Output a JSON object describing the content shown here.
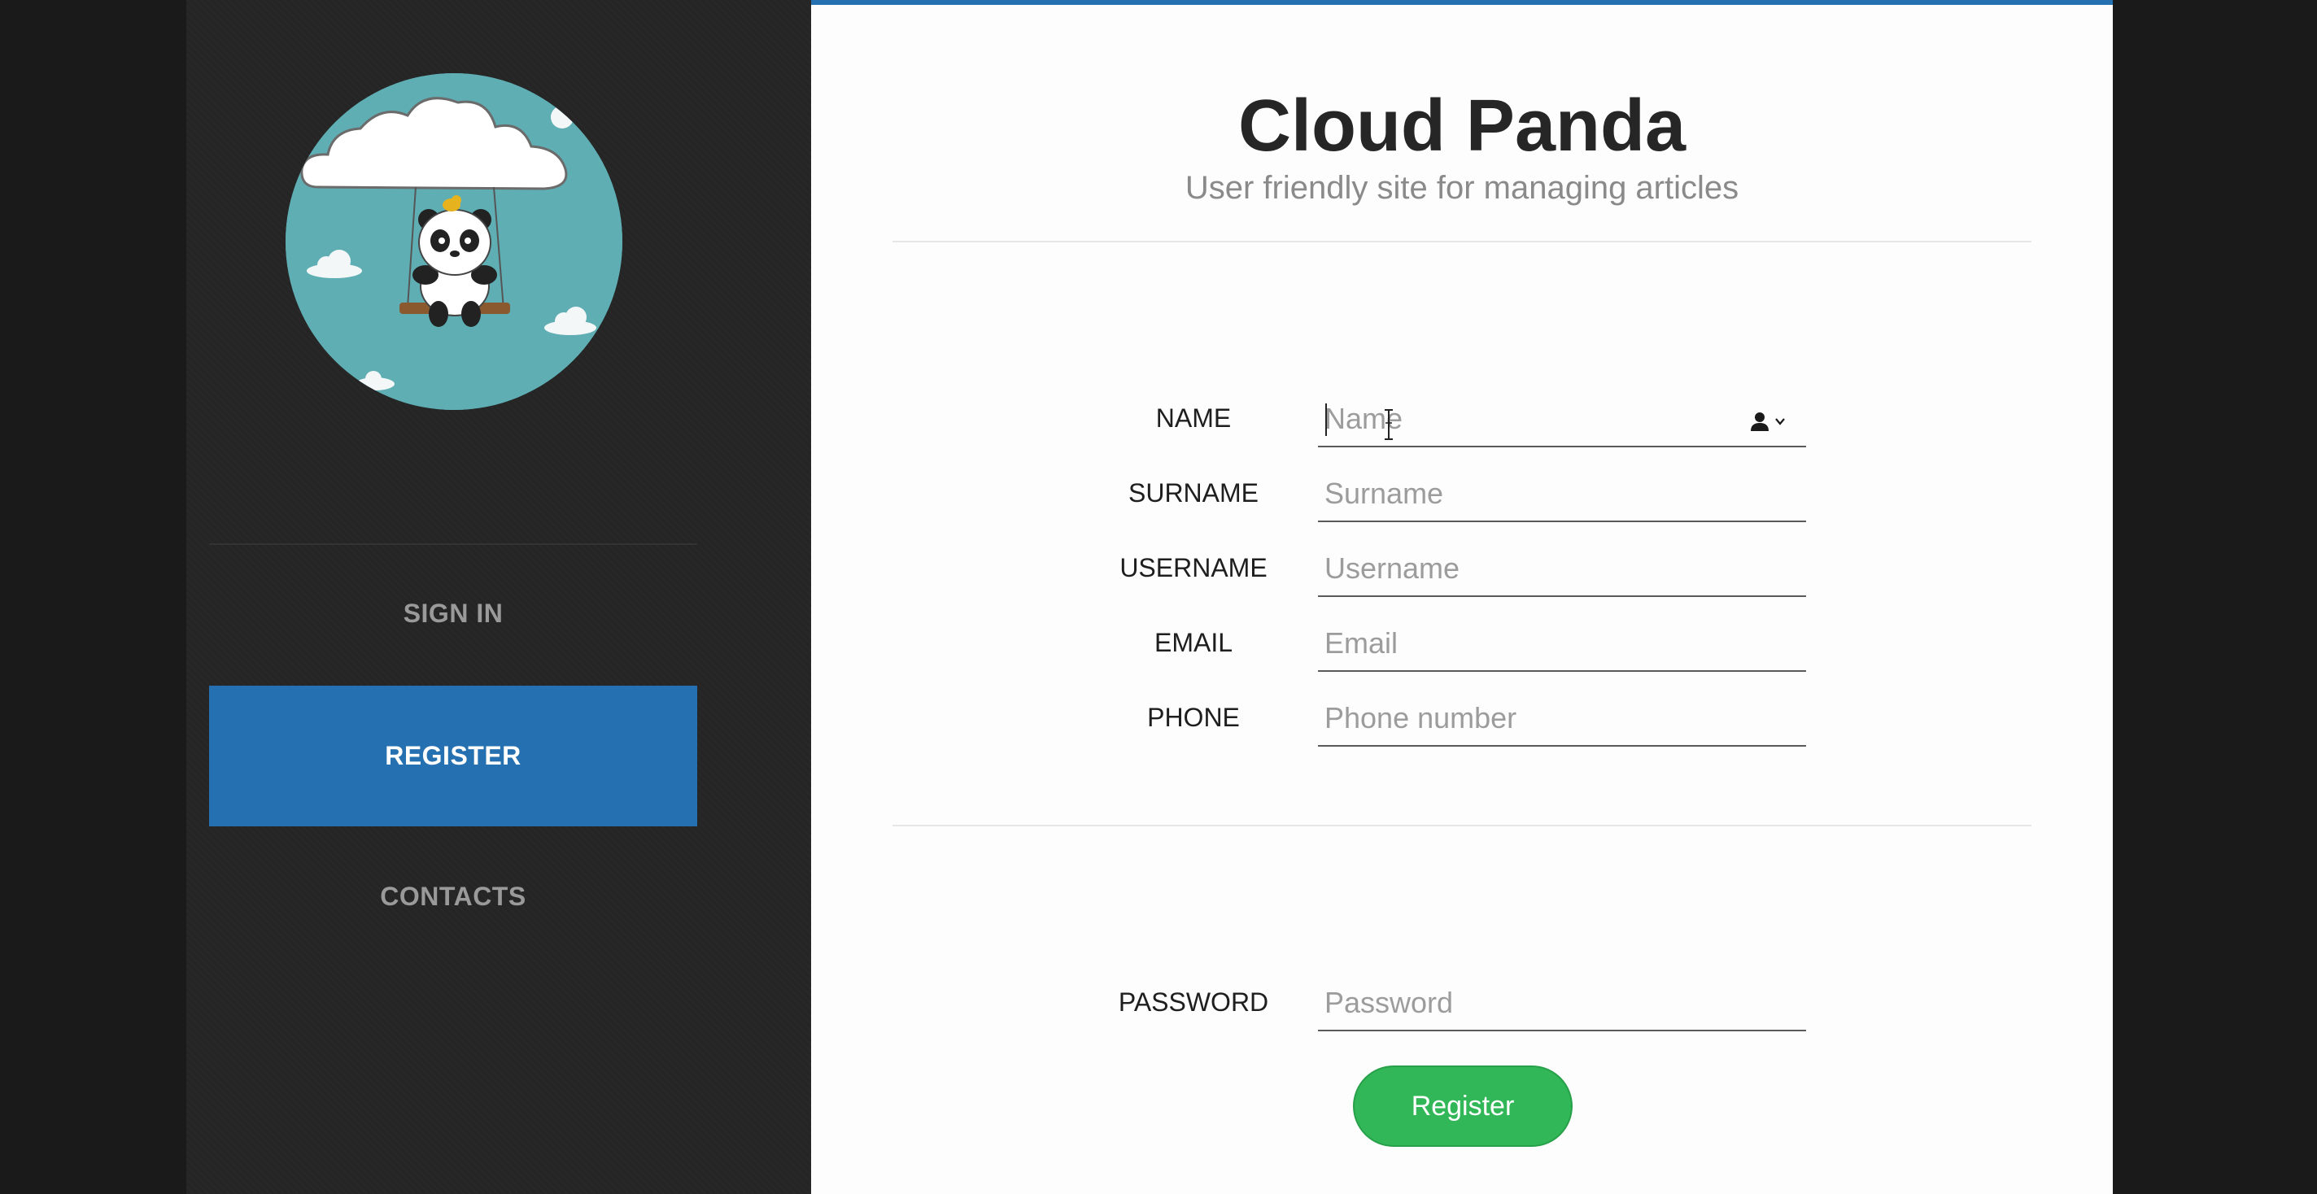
{
  "nav": {
    "items": [
      {
        "label": "SIGN IN"
      },
      {
        "label": "REGISTER"
      },
      {
        "label": "CONTACTS"
      }
    ]
  },
  "header": {
    "title": "Cloud Panda",
    "subtitle": "User friendly site for managing articles"
  },
  "form": {
    "fields": [
      {
        "label": "NAME",
        "placeholder": "Name"
      },
      {
        "label": "SURNAME",
        "placeholder": "Surname"
      },
      {
        "label": "USERNAME",
        "placeholder": "Username"
      },
      {
        "label": "EMAIL",
        "placeholder": "Email"
      },
      {
        "label": "PHONE",
        "placeholder": "Phone number"
      }
    ],
    "password": {
      "label": "PASSWORD",
      "placeholder": "Password"
    },
    "submit_label": "Register"
  },
  "icons": {
    "logo": "cloud-panda-logo",
    "autofill": "contact-card-icon"
  },
  "colors": {
    "accent": "#2570b0",
    "button": "#31b757",
    "sidebar": "#252525"
  }
}
